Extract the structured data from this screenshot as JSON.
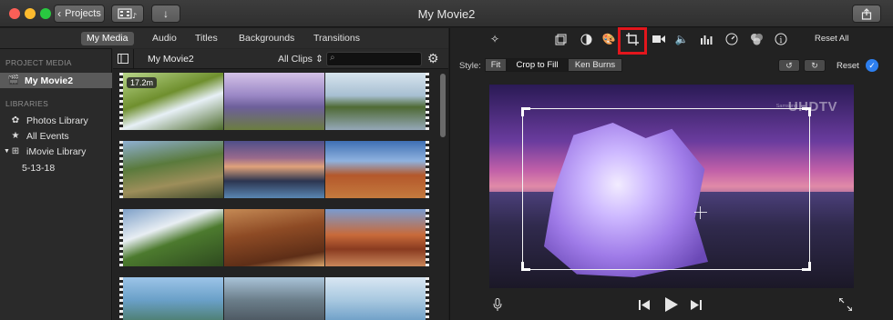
{
  "window": {
    "title": "My Movie2",
    "projects_label": "Projects",
    "back_icon": "chevron-left-icon",
    "share_icon": "share-icon"
  },
  "media_tabs": [
    "My Media",
    "Audio",
    "Titles",
    "Backgrounds",
    "Transitions"
  ],
  "sidebar": {
    "project_media_header": "PROJECT MEDIA",
    "project_item": "My Movie2",
    "libraries_header": "LIBRARIES",
    "library_items": [
      "Photos Library",
      "All Events",
      "iMovie Library"
    ],
    "event_item": "5-13-18"
  },
  "browser": {
    "title": "My Movie2",
    "filter": "All Clips",
    "filter_arrow": "⇕",
    "first_clip_duration": "17.2m"
  },
  "adjust_toolbar": {
    "reset_all": "Reset All",
    "highlighted_tool": "crop",
    "highlight_color": "#e3161c"
  },
  "crop_style": {
    "label": "Style:",
    "options": [
      "Fit",
      "Crop to Fill",
      "Ken Burns"
    ],
    "selected": "Crop to Fill",
    "reset": "Reset",
    "confirm_color": "#2d7ff0"
  },
  "viewer": {
    "watermark_small": "Samsung",
    "watermark": "UHDTV"
  }
}
